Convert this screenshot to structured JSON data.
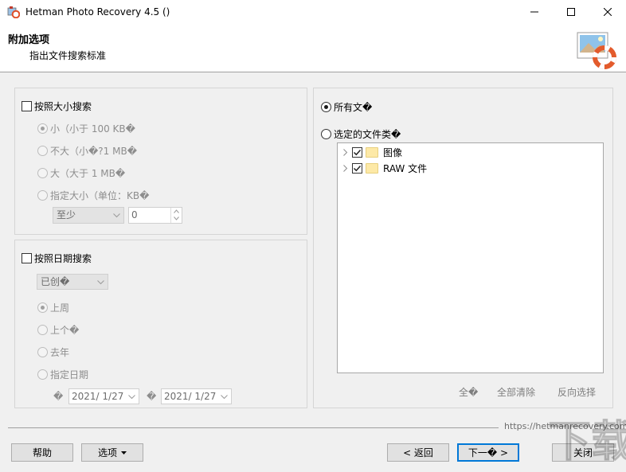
{
  "window": {
    "title": "Hetman Photo Recovery 4.5 ()",
    "icon": "app-logo-icon"
  },
  "header": {
    "title": "附加选项",
    "subtitle": "指出文件搜索标准",
    "logo_icon": "lifebuoy-photo-icon"
  },
  "size_search": {
    "checkbox_label": "按照大小搜索",
    "checked": false,
    "options": [
      {
        "label": "小（小于 100 KB�",
        "selected": true
      },
      {
        "label": "不大（小�?1 MB�",
        "selected": false
      },
      {
        "label": "大（大于 1 MB�",
        "selected": false
      },
      {
        "label": "指定大小（单位：KB�",
        "selected": false
      }
    ],
    "min_combo_value": "至少",
    "size_value": "0"
  },
  "date_search": {
    "checkbox_label": "按照日期搜索",
    "checked": false,
    "type_combo_value": "已创�",
    "options": [
      {
        "label": "上周",
        "selected": true
      },
      {
        "label": "上个�",
        "selected": false
      },
      {
        "label": "去年",
        "selected": false
      },
      {
        "label": "指定日期",
        "selected": false
      }
    ],
    "range_prefix": "�",
    "from_date": "2021/  1/27",
    "to_prefix": "�",
    "to_date": "2021/  1/27"
  },
  "file_types": {
    "all_files_label": "所有文�",
    "all_files_selected": true,
    "selected_types_label": "选定的文件类�",
    "selected_types_selected": false,
    "tree_items": [
      {
        "label": "图像",
        "checked": true
      },
      {
        "label": "RAW 文件",
        "checked": true
      }
    ],
    "select_all_label": "全�",
    "clear_all_label": "全部清除",
    "invert_label": "反向选择"
  },
  "footer": {
    "url": "https://hetmanrecovery.com",
    "help_label": "帮助",
    "options_label": "选项",
    "back_label": "< 返回",
    "next_label": "下一� >",
    "close_label": "关闭"
  },
  "watermark": {
    "text": "下载吧"
  },
  "colors": {
    "accent": "#0078d7",
    "folder": "#fde9a7"
  }
}
